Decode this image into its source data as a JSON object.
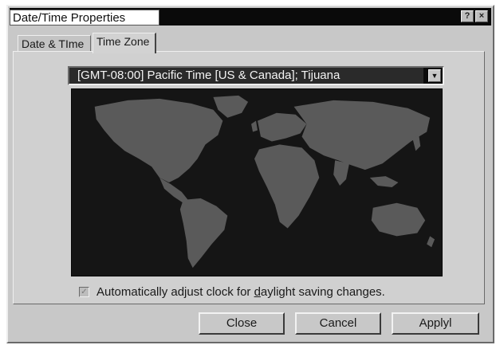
{
  "window": {
    "title": "Date/Time Properties"
  },
  "title_buttons": {
    "help": "?",
    "close": "×"
  },
  "tabs": [
    {
      "label": "Date & TIme"
    },
    {
      "label": "Time Zone"
    }
  ],
  "timezone": {
    "selected": "[GMT-08:00] Pacific Time [US & Canada]; Tijuana"
  },
  "map": {
    "land_color": "#5a5a5a",
    "ocean_color": "#151515"
  },
  "dst": {
    "checked": true,
    "label_before": "Automatically adjust clock for ",
    "label_accel": "d",
    "label_after": "aylight saving changes."
  },
  "buttons": {
    "close": "Close",
    "cancel": "Cancel",
    "apply": "Applyl"
  }
}
